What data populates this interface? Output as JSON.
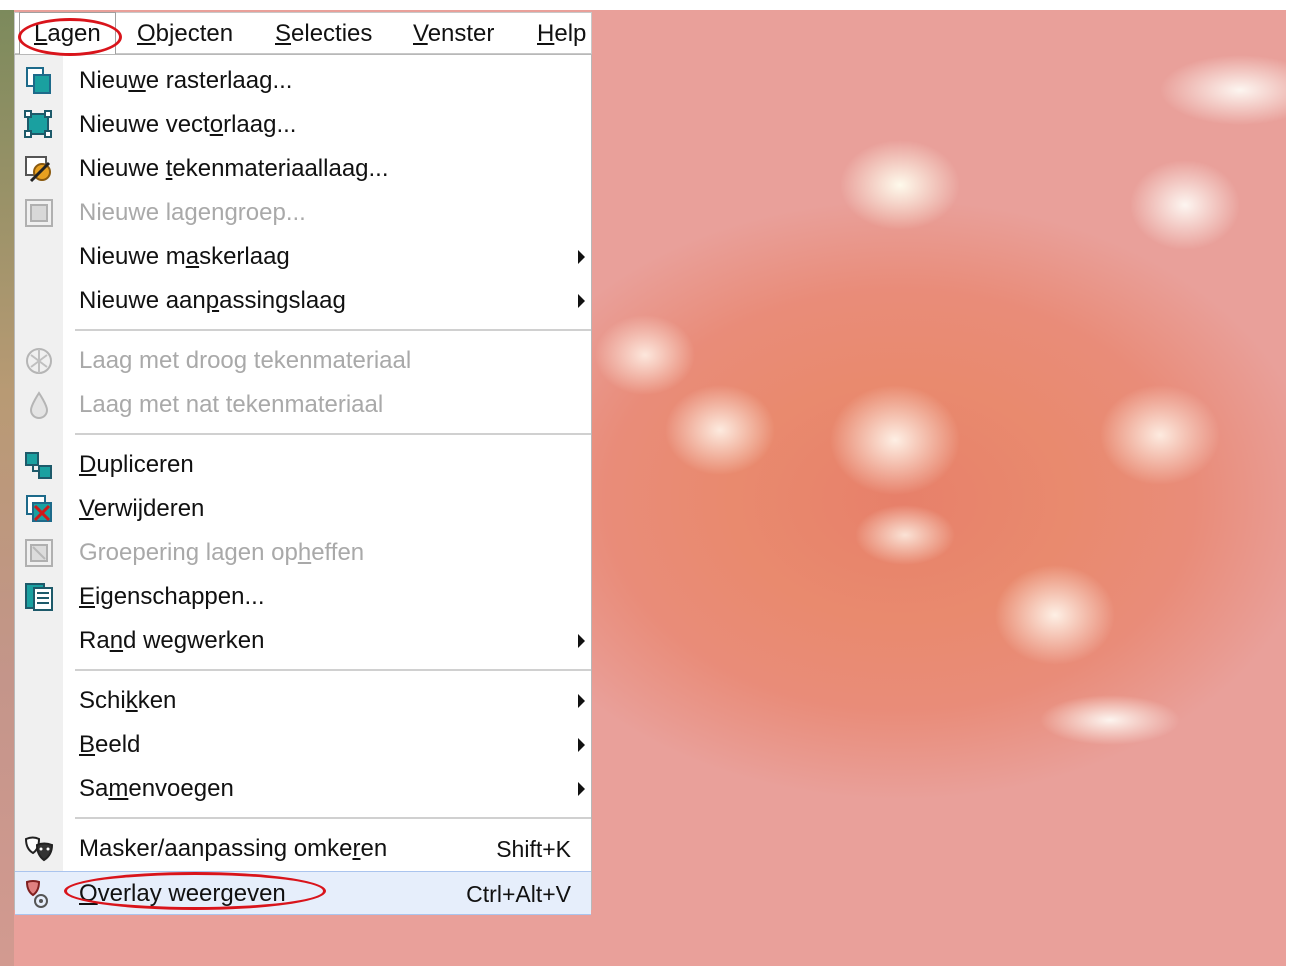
{
  "menubar": {
    "items": [
      {
        "label_pre": "",
        "label_u": "L",
        "label_post": "agen"
      },
      {
        "label_pre": "",
        "label_u": "O",
        "label_post": "bjecten"
      },
      {
        "label_pre": "",
        "label_u": "S",
        "label_post": "electies"
      },
      {
        "label_pre": "",
        "label_u": "V",
        "label_post": "enster"
      },
      {
        "label_pre": "",
        "label_u": "H",
        "label_post": "elp"
      }
    ]
  },
  "menu": {
    "items": [
      {
        "pre": "Nieu",
        "u": "w",
        "post": "e rasterlaag...",
        "icon": "new-raster-layer-icon",
        "disabled": false,
        "submenu": false,
        "shortcut": ""
      },
      {
        "pre": "Nieuwe vect",
        "u": "o",
        "post": "rlaag...",
        "icon": "new-vector-layer-icon",
        "disabled": false,
        "submenu": false,
        "shortcut": ""
      },
      {
        "pre": "Nieuwe ",
        "u": "t",
        "post": "ekenmateriaallaag...",
        "icon": "new-art-media-layer-icon",
        "disabled": false,
        "submenu": false,
        "shortcut": ""
      },
      {
        "pre": "Nieuwe lagen",
        "u": "g",
        "post": "roep...",
        "icon": "new-layer-group-icon",
        "disabled": true,
        "submenu": false,
        "shortcut": ""
      },
      {
        "pre": "Nieuwe m",
        "u": "a",
        "post": "skerlaag",
        "icon": "",
        "disabled": false,
        "submenu": true,
        "shortcut": ""
      },
      {
        "pre": "Nieuwe aan",
        "u": "p",
        "post": "assingslaag",
        "icon": "",
        "disabled": false,
        "submenu": true,
        "shortcut": ""
      },
      {
        "pre": "Laag met droog tekenmateriaal",
        "u": "",
        "post": "",
        "icon": "dry-media-icon",
        "disabled": true,
        "submenu": false,
        "shortcut": ""
      },
      {
        "pre": "Laag met nat tekenmateriaal",
        "u": "",
        "post": "",
        "icon": "wet-media-icon",
        "disabled": true,
        "submenu": false,
        "shortcut": ""
      },
      {
        "pre": "",
        "u": "D",
        "post": "upliceren",
        "icon": "duplicate-icon",
        "disabled": false,
        "submenu": false,
        "shortcut": ""
      },
      {
        "pre": "",
        "u": "V",
        "post": "erwijderen",
        "icon": "delete-layer-icon",
        "disabled": false,
        "submenu": false,
        "shortcut": ""
      },
      {
        "pre": "Groepering lagen op",
        "u": "h",
        "post": "effen",
        "icon": "ungroup-layers-icon",
        "disabled": true,
        "submenu": false,
        "shortcut": ""
      },
      {
        "pre": "",
        "u": "E",
        "post": "igenschappen...",
        "icon": "properties-icon",
        "disabled": false,
        "submenu": false,
        "shortcut": ""
      },
      {
        "pre": "Ra",
        "u": "n",
        "post": "d wegwerken",
        "icon": "",
        "disabled": false,
        "submenu": true,
        "shortcut": ""
      },
      {
        "pre": "Schi",
        "u": "k",
        "post": "ken",
        "icon": "",
        "disabled": false,
        "submenu": true,
        "shortcut": ""
      },
      {
        "pre": "",
        "u": "B",
        "post": "eeld",
        "icon": "",
        "disabled": false,
        "submenu": true,
        "shortcut": ""
      },
      {
        "pre": "Sa",
        "u": "m",
        "post": "envoegen",
        "icon": "",
        "disabled": false,
        "submenu": true,
        "shortcut": ""
      },
      {
        "pre": "Masker/aanpassing omke",
        "u": "r",
        "post": "en",
        "icon": "invert-mask-icon",
        "disabled": false,
        "submenu": false,
        "shortcut": "Shift+K"
      },
      {
        "pre": "",
        "u": "O",
        "post": "verlay weergeven",
        "icon": "view-overlay-icon",
        "disabled": false,
        "submenu": false,
        "shortcut": "Ctrl+Alt+V"
      }
    ]
  },
  "colors": {
    "annotation": "#d9141b",
    "disabled_text": "#a9a9a9",
    "icon_teal": "#1aa0a0",
    "icon_blue": "#2a5fb0"
  }
}
